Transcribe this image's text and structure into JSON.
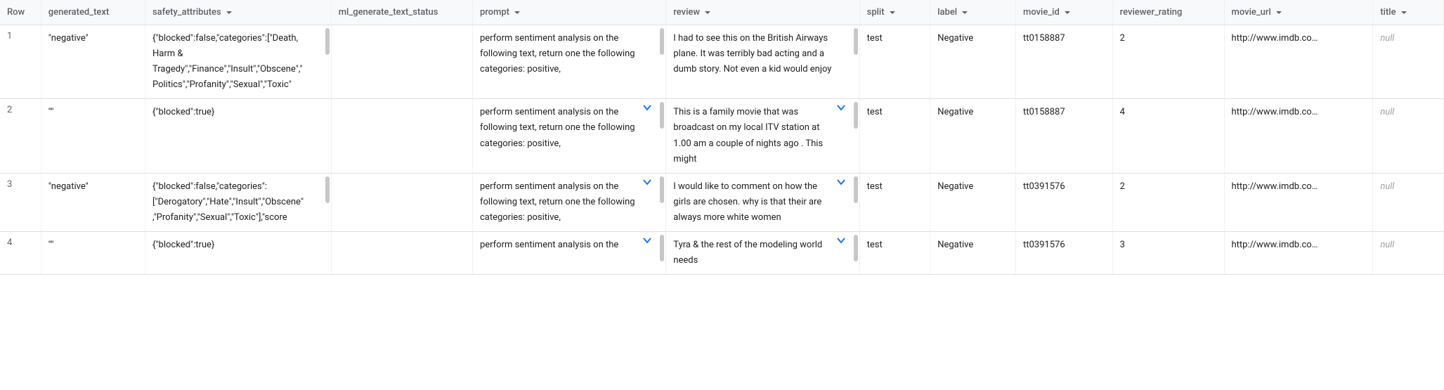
{
  "columns": {
    "row": "Row",
    "generated_text": "generated_text",
    "safety_attributes": "safety_attributes",
    "ml_generate_text_status": "ml_generate_text_status",
    "prompt": "prompt",
    "review": "review",
    "split": "split",
    "label": "label",
    "movie_id": "movie_id",
    "reviewer_rating": "reviewer_rating",
    "movie_url": "movie_url",
    "title": "title"
  },
  "rows": [
    {
      "n": "1",
      "generated_text": "\"negative\"",
      "safety_attributes": "{\"blocked\":false,\"categories\":[\"Death, Harm & Tragedy\",\"Finance\",\"Insult\",\"Obscene\",\"Politics\",\"Profanity\",\"Sexual\",\"Toxic\"",
      "ml_status": "",
      "prompt": "perform sentiment analysis on the following text, return one the following categories: positive,",
      "review": "I had to see this on the British Airways plane. It was terribly bad acting and a dumb story. Not even a kid would enjoy",
      "split": "test",
      "label": "Negative",
      "movie_id": "tt0158887",
      "rating": "2",
      "url": "http://www.imdb.co…",
      "title": "null",
      "show_chevron": false
    },
    {
      "n": "2",
      "generated_text": "\"\"",
      "safety_attributes": "{\"blocked\":true}",
      "ml_status": "",
      "prompt": "perform sentiment analysis on the following text, return one the following categories: positive,",
      "review": "This is a family movie that was broadcast on my local ITV station at 1.00 am a couple of nights ago . This might",
      "split": "test",
      "label": "Negative",
      "movie_id": "tt0158887",
      "rating": "4",
      "url": "http://www.imdb.co…",
      "title": "null",
      "show_chevron": true
    },
    {
      "n": "3",
      "generated_text": "\"negative\"",
      "safety_attributes": "{\"blocked\":false,\"categories\":[\"Derogatory\",\"Hate\",\"Insult\",\"Obscene\",\"Profanity\",\"Sexual\",\"Toxic\"],\"score",
      "ml_status": "",
      "prompt": "perform sentiment analysis on the following text, return one the following categories: positive,",
      "review": "I would like to comment on how the girls are chosen. why is that their are always more white women",
      "split": "test",
      "label": "Negative",
      "movie_id": "tt0391576",
      "rating": "2",
      "url": "http://www.imdb.co…",
      "title": "null",
      "show_chevron": true
    },
    {
      "n": "4",
      "generated_text": "\"\"",
      "safety_attributes": "{\"blocked\":true}",
      "ml_status": "",
      "prompt": "perform sentiment analysis on the",
      "review": "Tyra & the rest of the modeling world needs",
      "split": "test",
      "label": "Negative",
      "movie_id": "tt0391576",
      "rating": "3",
      "url": "http://www.imdb.co…",
      "title": "null",
      "show_chevron": true
    }
  ]
}
